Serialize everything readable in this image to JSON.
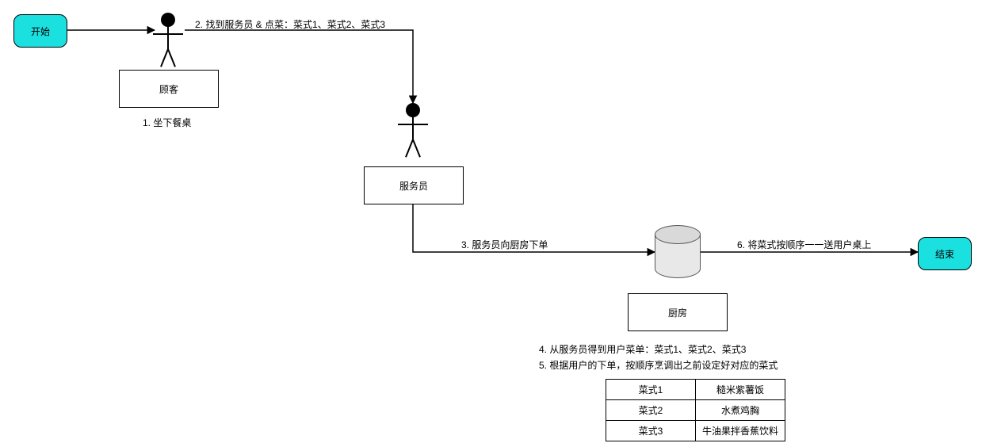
{
  "nodes": {
    "start": "开始",
    "end": "结束",
    "customer_box": "顾客",
    "waiter_box": "服务员",
    "kitchen_box": "厨房"
  },
  "edges": {
    "edge2": "2. 找到服务员 & 点菜：菜式1、菜式2、菜式3",
    "edge3": "3. 服务员向厨房下单",
    "edge6": "6. 将菜式按顺序一一送用户桌上"
  },
  "captions": {
    "customer_caption": "1. 坐下餐桌",
    "kitchen_line1": "4. 从服务员得到用户菜单：菜式1、菜式2、菜式3",
    "kitchen_line2": "5. 根据用户的下单，按顺序烹调出之前设定好对应的菜式"
  },
  "chart_data": {
    "type": "table",
    "rows": [
      [
        "菜式1",
        "糙米紫薯饭"
      ],
      [
        "菜式2",
        "水煮鸡胸"
      ],
      [
        "菜式3",
        "牛油果拌香蕉饮料"
      ]
    ]
  }
}
